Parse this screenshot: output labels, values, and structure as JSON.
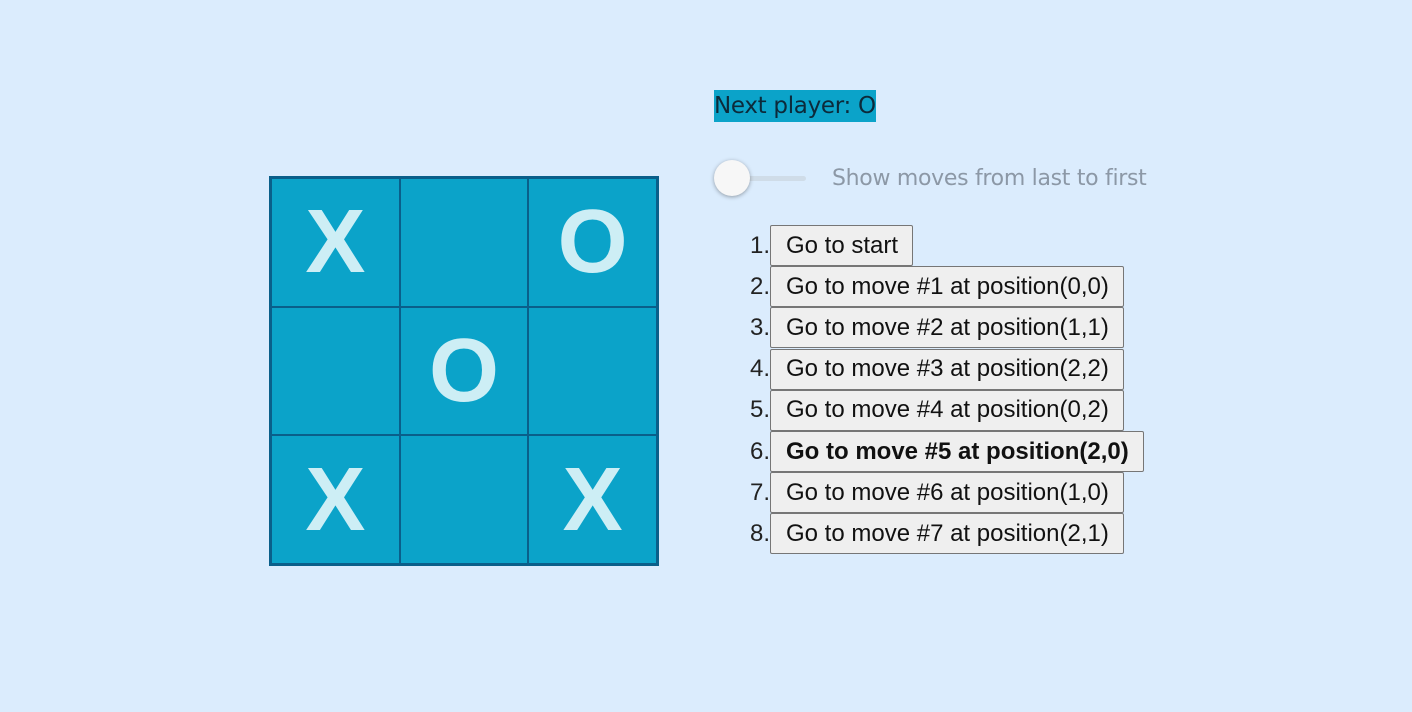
{
  "board": {
    "squares": [
      "X",
      "",
      "O",
      "",
      "O",
      "",
      "X",
      "",
      "X"
    ]
  },
  "status": "Next player: O",
  "toggle": {
    "label": "Show moves from last to first",
    "checked": false
  },
  "moves": [
    {
      "number": "1.",
      "label": "Go to start",
      "current": false
    },
    {
      "number": "2.",
      "label": "Go to move #1 at position(0,0)",
      "current": false
    },
    {
      "number": "3.",
      "label": "Go to move #2 at position(1,1)",
      "current": false
    },
    {
      "number": "4.",
      "label": "Go to move #3 at position(2,2)",
      "current": false
    },
    {
      "number": "5.",
      "label": "Go to move #4 at position(0,2)",
      "current": false
    },
    {
      "number": "6.",
      "label": "Go to move #5 at position(2,0)",
      "current": true
    },
    {
      "number": "7.",
      "label": "Go to move #6 at position(1,0)",
      "current": false
    },
    {
      "number": "8.",
      "label": "Go to move #7 at position(2,1)",
      "current": false
    }
  ],
  "colors": {
    "background": "#dbecfd",
    "square": "#0ba3c9",
    "square_border": "#0a5f8a",
    "mark": "#cdeef5",
    "toggle_label": "#8c98a6"
  }
}
